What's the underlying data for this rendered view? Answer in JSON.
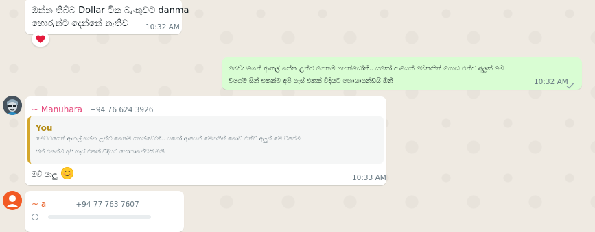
{
  "messages": [
    {
      "text_line1": "ඔන්න තිබ්බ Dollar ටික බැංකුවට danma",
      "text_line2": "හොරුන්ට දෙන්නේ නැතිව",
      "time": "10:32 AM",
      "reaction": "heart"
    },
    {
      "text_line1": "මෙච්චගෙන් ආතල් ගන්න උන්ට ගෙනම් ගහන්ඩෝනී.. යකෝ ආයෙත් මේකතින් ගොඩ එන්ඩ අලුක් මේ",
      "text_line2": "වගේම සින් එකක්ම අපි ගෑස් එකක් විදියට හොයාගන්ඩයි ඕනි",
      "time": "10:32 AM",
      "status": "read"
    },
    {
      "sender": "~ Manuhara",
      "phone": "+94 76 624 3926",
      "quote_author": "You",
      "quote_line1": "මෙච්චගෙන් ආතල් ගන්න උන්ට ගෙනම් ගහන්ඩෝනී.. යකෝ ආයෙත් මේකතින් ගොඩ එන්ඩ අලුක් මේ වගේම",
      "quote_line2": "සින් එකක්ම අපි ගෑස් එකක් විදියට හොයාගන්ඩයි ඕනි",
      "text": "ඔව් යාලු",
      "emoji": "smiling-face",
      "time": "10:33 AM"
    },
    {
      "sender": "~ a",
      "phone": "+94 77 763 7607"
    }
  ],
  "colors": {
    "chat_background": "#efeae2",
    "incoming_bubble": "#ffffff",
    "outgoing_bubble": "#d9fdd3",
    "sender_manuhara": "#e5487b",
    "sender_a": "#e8622a",
    "read_tick": "#8696a0",
    "quote_accent": "#d4a72c"
  }
}
